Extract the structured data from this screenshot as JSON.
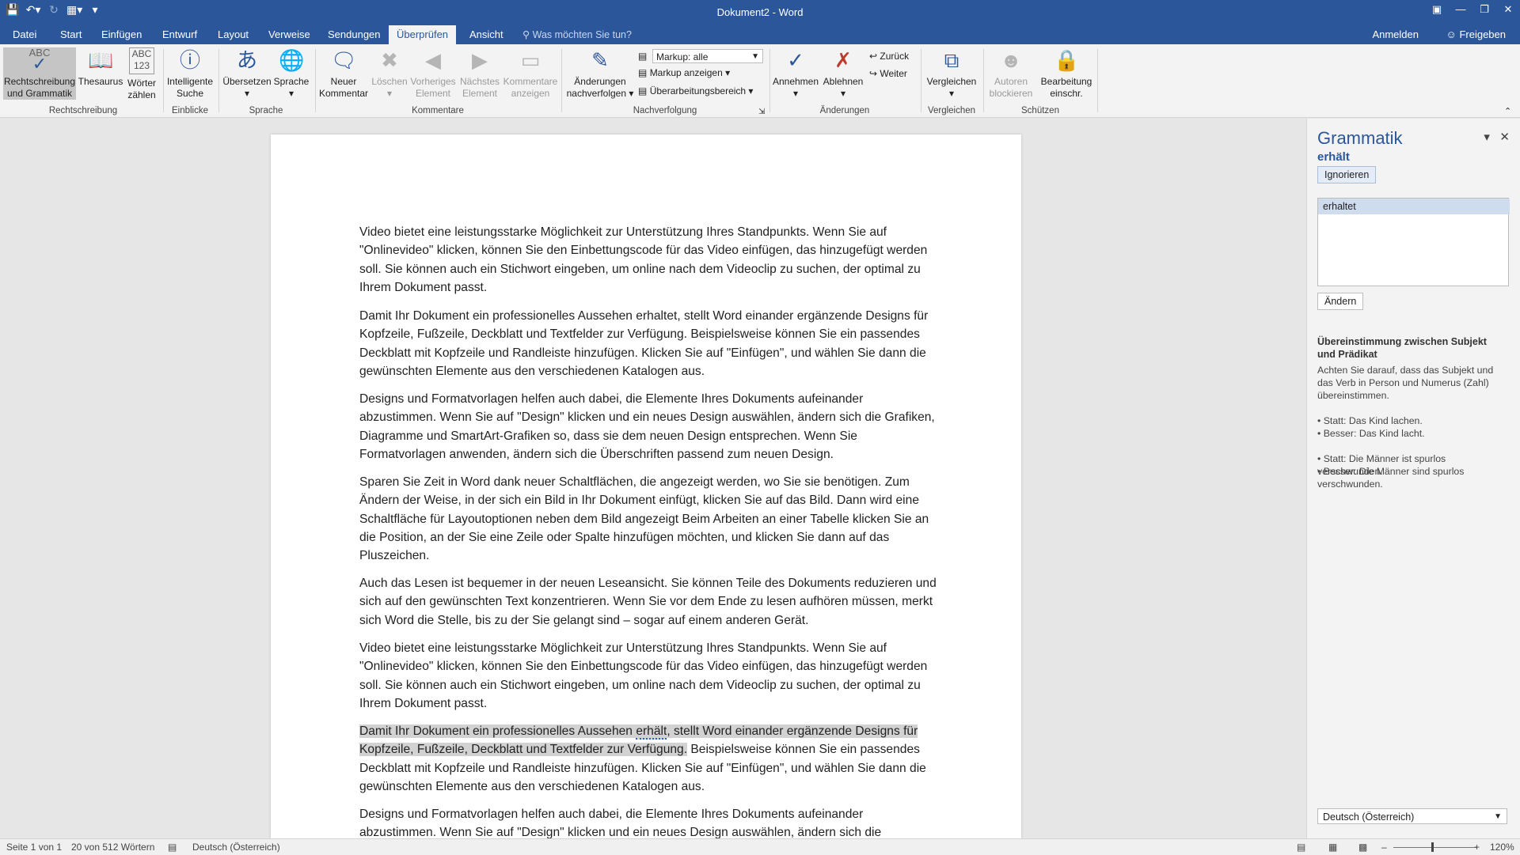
{
  "titlebar": {
    "title": "Dokument2 - Word",
    "qat": [
      "save-icon",
      "undo-icon",
      "redo-icon",
      "touch-mode-icon",
      "customize-icon"
    ]
  },
  "tabs": {
    "items": [
      "Datei",
      "Start",
      "Einfügen",
      "Entwurf",
      "Layout",
      "Verweise",
      "Sendungen",
      "Überprüfen",
      "Ansicht"
    ],
    "active": "Überprüfen",
    "tellme": "Was möchten Sie tun?",
    "signin": "Anmelden",
    "share": "Freigeben"
  },
  "ribbon": {
    "spelling": {
      "icon_text": "ABC",
      "label1": "Rechtschreibung",
      "label2": "und Grammatik"
    },
    "thesaurus": "Thesaurus",
    "wordcount": {
      "icon_text": "ABC 123",
      "label1": "Wörter",
      "label2": "zählen"
    },
    "smartlookup": {
      "label1": "Intelligente",
      "label2": "Suche"
    },
    "translate": "Übersetzen",
    "language": "Sprache",
    "newcomment": {
      "label1": "Neuer",
      "label2": "Kommentar"
    },
    "delete": "Löschen",
    "prev": {
      "label1": "Vorheriges",
      "label2": "Element"
    },
    "next": {
      "label1": "Nächstes",
      "label2": "Element"
    },
    "showcomments": {
      "label1": "Kommentare",
      "label2": "anzeigen"
    },
    "track": {
      "label1": "Änderungen",
      "label2": "nachverfolgen"
    },
    "markup_dropdown": "Markup: alle",
    "show_markup": "Markup anzeigen",
    "review_pane": "Überarbeitungsbereich",
    "accept": "Annehmen",
    "reject": "Ablehnen",
    "back": "Zurück",
    "forward": "Weiter",
    "compare": "Vergleichen",
    "block_authors": {
      "label1": "Autoren",
      "label2": "blockieren"
    },
    "restrict": {
      "label1": "Bearbeitung",
      "label2": "einschr."
    },
    "groups": [
      "Rechtschreibung",
      "Einblicke",
      "Sprache",
      "Kommentare",
      "Nachverfolgung",
      "Änderungen",
      "Vergleichen",
      "Schützen"
    ]
  },
  "document": {
    "p1": "Video bietet eine leistungsstarke Möglichkeit zur Unterstützung Ihres Standpunkts. Wenn Sie auf \"Onlinevideo\" klicken, können Sie den Einbettungscode für das Video einfügen, das hinzugefügt werden soll. Sie können auch ein Stichwort eingeben, um online nach dem Videoclip zu suchen, der optimal zu Ihrem Dokument passt.",
    "p2": "Damit Ihr Dokument ein professionelles Aussehen erhaltet, stellt Word einander ergänzende Designs für Kopfzeile, Fußzeile, Deckblatt und Textfelder zur Verfügung. Beispielsweise können Sie ein passendes Deckblatt mit Kopfzeile und Randleiste hinzufügen. Klicken Sie auf \"Einfügen\", und wählen Sie dann die gewünschten Elemente aus den verschiedenen Katalogen aus.",
    "p3": "Designs und Formatvorlagen helfen auch dabei, die Elemente Ihres Dokuments aufeinander abzustimmen. Wenn Sie auf \"Design\" klicken und ein neues Design auswählen, ändern sich die Grafiken, Diagramme und SmartArt-Grafiken so, dass sie dem neuen Design entsprechen. Wenn Sie Formatvorlagen anwenden, ändern sich die Überschriften passend zum neuen Design.",
    "p4": "Sparen Sie Zeit in Word dank neuer Schaltflächen, die angezeigt werden, wo Sie sie benötigen. Zum Ändern der Weise, in der sich ein Bild in Ihr Dokument einfügt, klicken Sie auf das Bild. Dann wird eine Schaltfläche für Layoutoptionen neben dem Bild angezeigt Beim Arbeiten an einer Tabelle klicken Sie an die Position, an der Sie eine Zeile oder Spalte hinzufügen möchten, und klicken Sie dann auf das Pluszeichen.",
    "p5": "Auch das Lesen ist bequemer in der neuen Leseansicht. Sie können Teile des Dokuments reduzieren und sich auf den gewünschten Text konzentrieren. Wenn Sie vor dem Ende zu lesen aufhören müssen, merkt sich Word die Stelle, bis zu der Sie gelangt sind – sogar auf einem anderen Gerät.",
    "p6": "Video bietet eine leistungsstarke Möglichkeit zur Unterstützung Ihres Standpunkts. Wenn Sie auf \"Onlinevideo\" klicken, können Sie den Einbettungscode für das Video einfügen, das hinzugefügt werden soll. Sie können auch ein Stichwort eingeben, um online nach dem Videoclip zu suchen, der optimal zu Ihrem Dokument passt.",
    "p7_a": "Damit Ihr Dokument ein professionelles Aussehen ",
    "p7_err": "erhält",
    "p7_b": ", stellt Word einander ergänzende Designs für Kopfzeile, Fußzeile, Deckblatt und Textfelder zur Verfügung.",
    "p7_c": " Beispielsweise können Sie ein passendes Deckblatt mit Kopfzeile und Randleiste hinzufügen. Klicken Sie auf \"Einfügen\", und wählen Sie dann die gewünschten Elemente aus den verschiedenen Katalogen aus.",
    "p8": "Designs und Formatvorlagen helfen auch dabei, die Elemente Ihres Dokuments aufeinander abzustimmen. Wenn Sie auf \"Design\" klicken und ein neues Design auswählen, ändern sich die"
  },
  "pane": {
    "title": "Grammatik",
    "word": "erhält",
    "ignore": "Ignorieren",
    "suggestion": "erhaltet",
    "change": "Ändern",
    "rule_title": "Übereinstimmung zwischen Subjekt und Prädikat",
    "rule_text": "Achten Sie darauf, dass das Subjekt und das Verb in Person und Numerus (Zahl) übereinstimmen.",
    "ex1": "• Statt: Das Kind lachen.",
    "ex2": "• Besser: Das Kind lacht.",
    "ex3": "• Statt: Die Männer ist spurlos verschwunden.",
    "ex4": "• Besser: Die Männer sind spurlos verschwunden.",
    "language": "Deutsch (Österreich)"
  },
  "status": {
    "page": "Seite 1 von 1",
    "words": "20 von 512 Wörtern",
    "language": "Deutsch (Österreich)",
    "zoom": "120%"
  }
}
